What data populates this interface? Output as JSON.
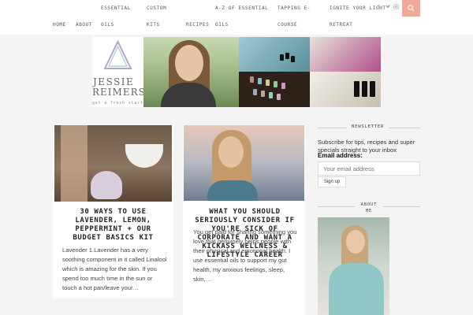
{
  "nav": {
    "top_items": [
      "ESSENTIAL",
      "CUSTOM",
      "A-Z OF ESSENTIAL",
      "TAPPING E-",
      "IGNITE YOUR LIGHT"
    ],
    "second_items": [
      "HOME",
      "ABOUT",
      "OILS",
      "KITS",
      "RECIPES",
      "OILS",
      "COURSE",
      "RETREAT"
    ],
    "social_icons": [
      "facebook-icon",
      "twitter-icon",
      "instagram-icon"
    ],
    "accent": "#f0a898"
  },
  "logo": {
    "line1": "JESSIE",
    "line2": "REIMERS",
    "tagline": "get a fresh start"
  },
  "posts": [
    {
      "title": "30 WAYS TO USE LAVENDER, LEMON, PEPPERMINT + OUR BUDGET BASICS KIT",
      "excerpt": "Lavender 1.Lavender has a very soothing component in it called Linalool which is amazing for the skin. If you spend too much time in the sun or touch a hot pan/leave your…"
    },
    {
      "title": "WHAT YOU SHOULD SERIOUSLY CONSIDER IF YOU'RE SICK OF CORPORATE AND WANT A KICKASS WELLNESS & LIFESTYLE CAREER",
      "excerpt": "You get paid for sharing something you love that genuinely helps people with their physical and emotional health. I use essential oils to support my gut health, my anxious feelings, sleep, skin,…"
    }
  ],
  "sidebar": {
    "newsletter_heading": "NEWSLETTER",
    "newsletter_text": "Subscribe for tips, recipes and super specials straight to your inbox",
    "email_label": "Email address:",
    "email_placeholder": "Your email address",
    "signup_label": "Sign up",
    "about_heading": "ABOUT ME"
  }
}
